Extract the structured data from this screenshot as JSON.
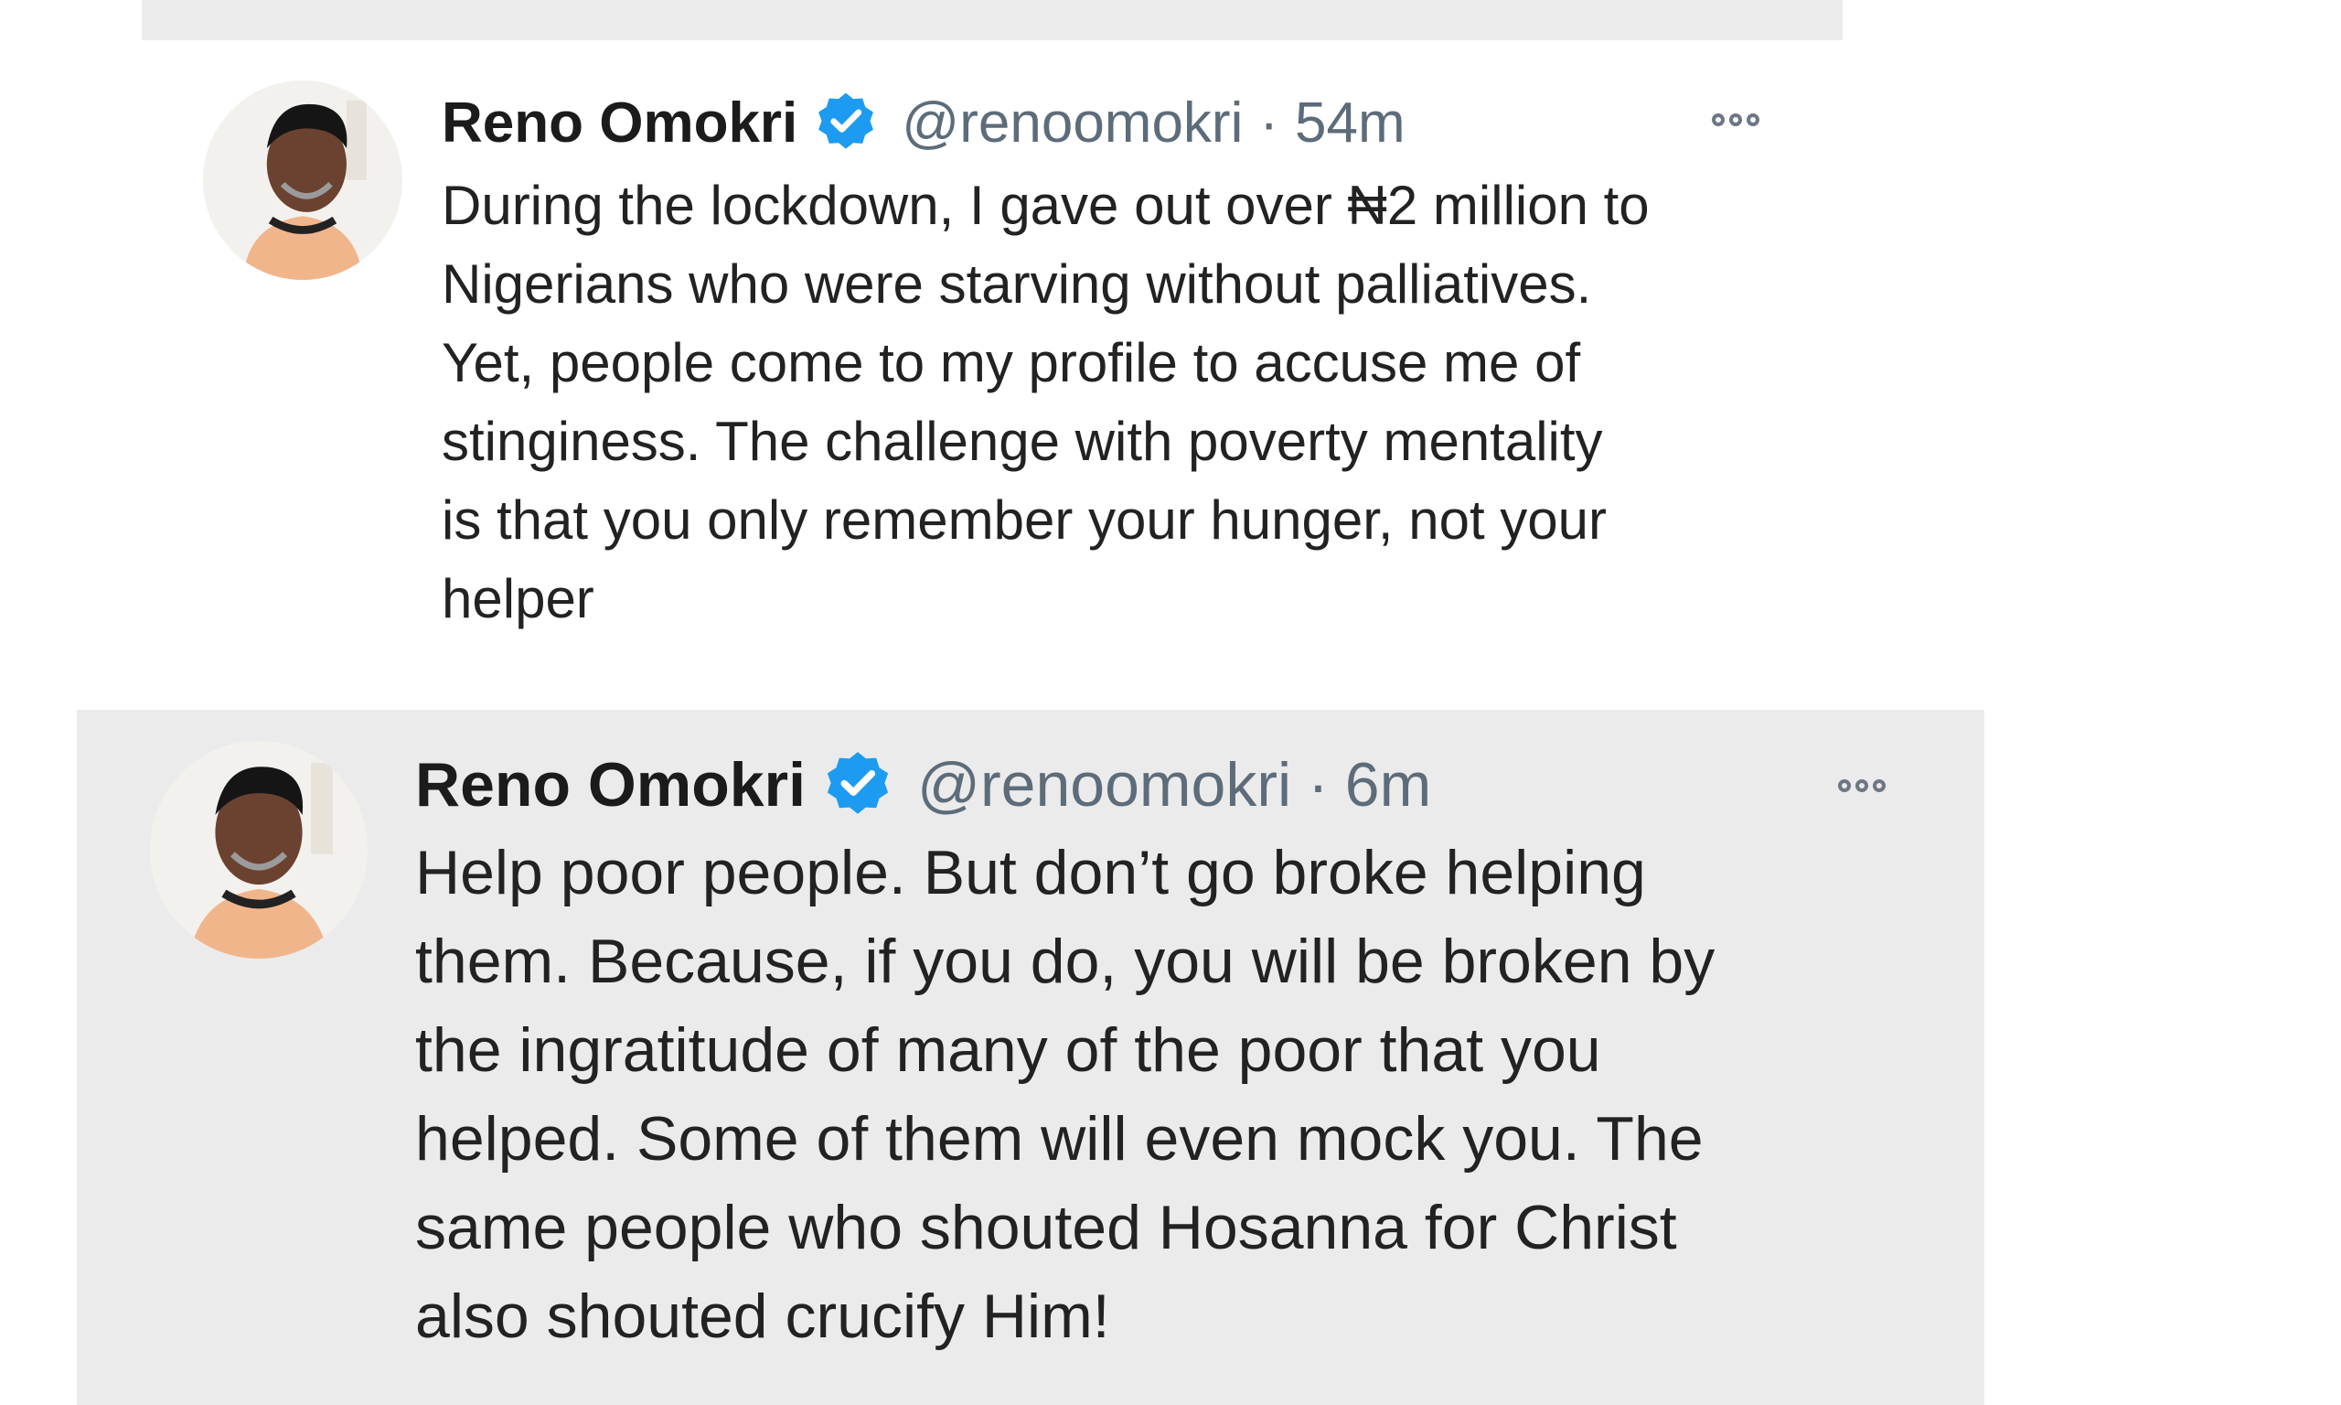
{
  "tweets": [
    {
      "author_name": "Reno Omokri",
      "handle": "@renoomokri",
      "separator": "·",
      "time": "54m",
      "text": "During the lockdown, I gave out over ₦2 million to\nNigerians who were starving without palliatives.\nYet, people come to my profile to accuse me of\nstinginess. The challenge with poverty mentality\nis that you only remember your hunger, not your\nhelper",
      "verified_icon": "verified-badge-icon",
      "more_icon": "more-options-icon"
    },
    {
      "author_name": "Reno Omokri",
      "handle": "@renoomokri",
      "separator": "·",
      "time": "6m",
      "text": "Help poor people. But don’t go broke helping\nthem. Because, if you do, you will be broken by\nthe ingratitude of many of the poor that you\nhelped. Some of them will even mock you. The\nsame people who shouted Hosanna for Christ\nalso shouted crucify Him!",
      "verified_icon": "verified-badge-icon",
      "more_icon": "more-options-icon"
    }
  ],
  "colors": {
    "verified_blue": "#1d9bf0",
    "muted_text": "#5d6c7a",
    "highlight_background": "#ebebeb"
  }
}
